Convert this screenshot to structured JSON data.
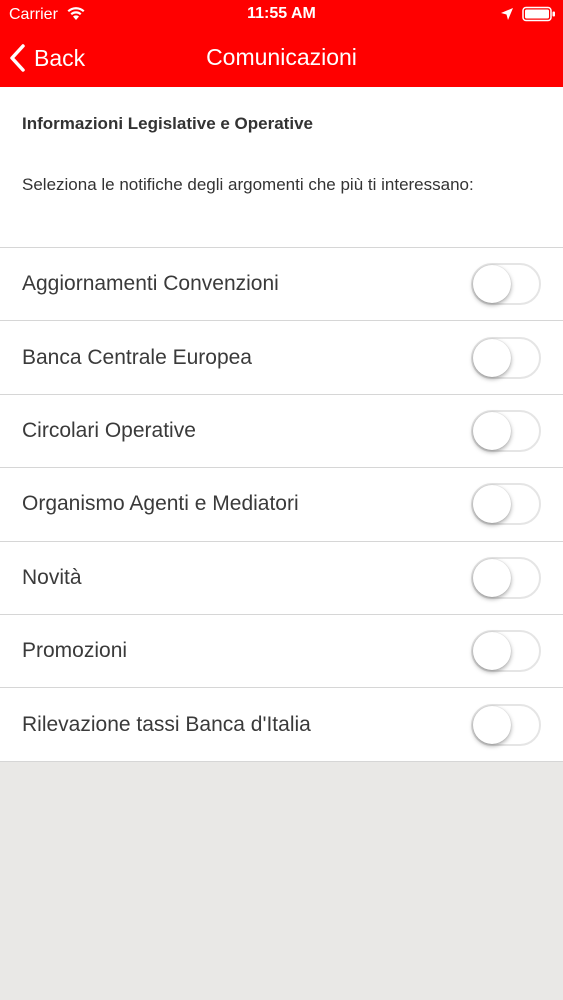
{
  "status_bar": {
    "carrier": "Carrier",
    "time": "11:55 AM",
    "icons": [
      "wifi-icon",
      "location-icon",
      "battery-icon"
    ]
  },
  "nav": {
    "back_label": "Back",
    "title": "Comunicazioni"
  },
  "section": {
    "title": "Informazioni Legislative e Operative",
    "description": "Seleziona le notifiche degli argomenti che più ti interessano:"
  },
  "topics": [
    {
      "label": "Aggiornamenti Convenzioni",
      "enabled": false
    },
    {
      "label": "Banca Centrale Europea",
      "enabled": false
    },
    {
      "label": "Circolari Operative",
      "enabled": false
    },
    {
      "label": "Organismo Agenti e Mediatori",
      "enabled": false
    },
    {
      "label": "Novità",
      "enabled": false
    },
    {
      "label": "Promozioni",
      "enabled": false
    },
    {
      "label": "Rilevazione tassi Banca d'Italia",
      "enabled": false
    }
  ],
  "colors": {
    "accent": "#ff0000",
    "background": "#e9e8e6",
    "text": "#333333"
  }
}
